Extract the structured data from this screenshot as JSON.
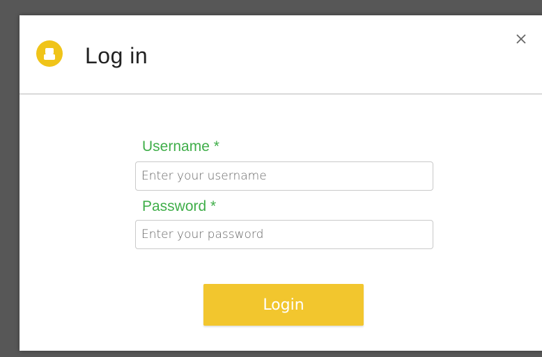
{
  "modal": {
    "title": "Log in",
    "header_icon": "user-icon",
    "close_icon": "close-icon",
    "close_glyph": "×"
  },
  "form": {
    "username": {
      "label": "Username *",
      "placeholder": "Enter your username",
      "value": ""
    },
    "password": {
      "label": "Password *",
      "placeholder": "Enter your password",
      "value": ""
    },
    "submit_label": "Login"
  },
  "colors": {
    "accent_yellow": "#f2c62e",
    "label_green": "#3fae49",
    "backdrop": "#575757"
  }
}
